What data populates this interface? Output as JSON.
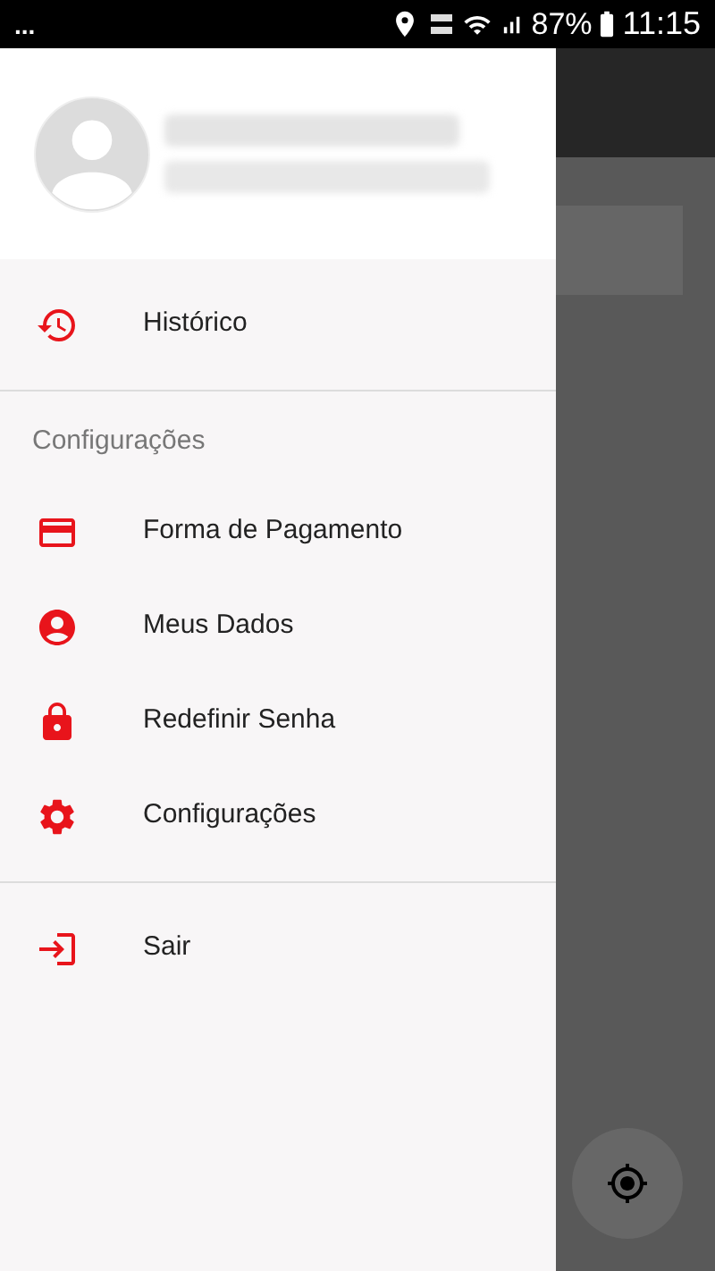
{
  "status_bar": {
    "notifications": "...",
    "battery": "87%",
    "time": "11:15"
  },
  "drawer": {
    "menu": [
      {
        "kind": "item",
        "label": "Histórico"
      },
      {
        "kind": "divider"
      },
      {
        "kind": "section",
        "label": "Configurações"
      },
      {
        "kind": "item",
        "label": "Forma de Pagamento"
      },
      {
        "kind": "item",
        "label": "Meus Dados"
      },
      {
        "kind": "item",
        "label": "Redefinir Senha"
      },
      {
        "kind": "item",
        "label": "Configurações"
      },
      {
        "kind": "divider"
      },
      {
        "kind": "item",
        "label": "Sair"
      }
    ]
  }
}
